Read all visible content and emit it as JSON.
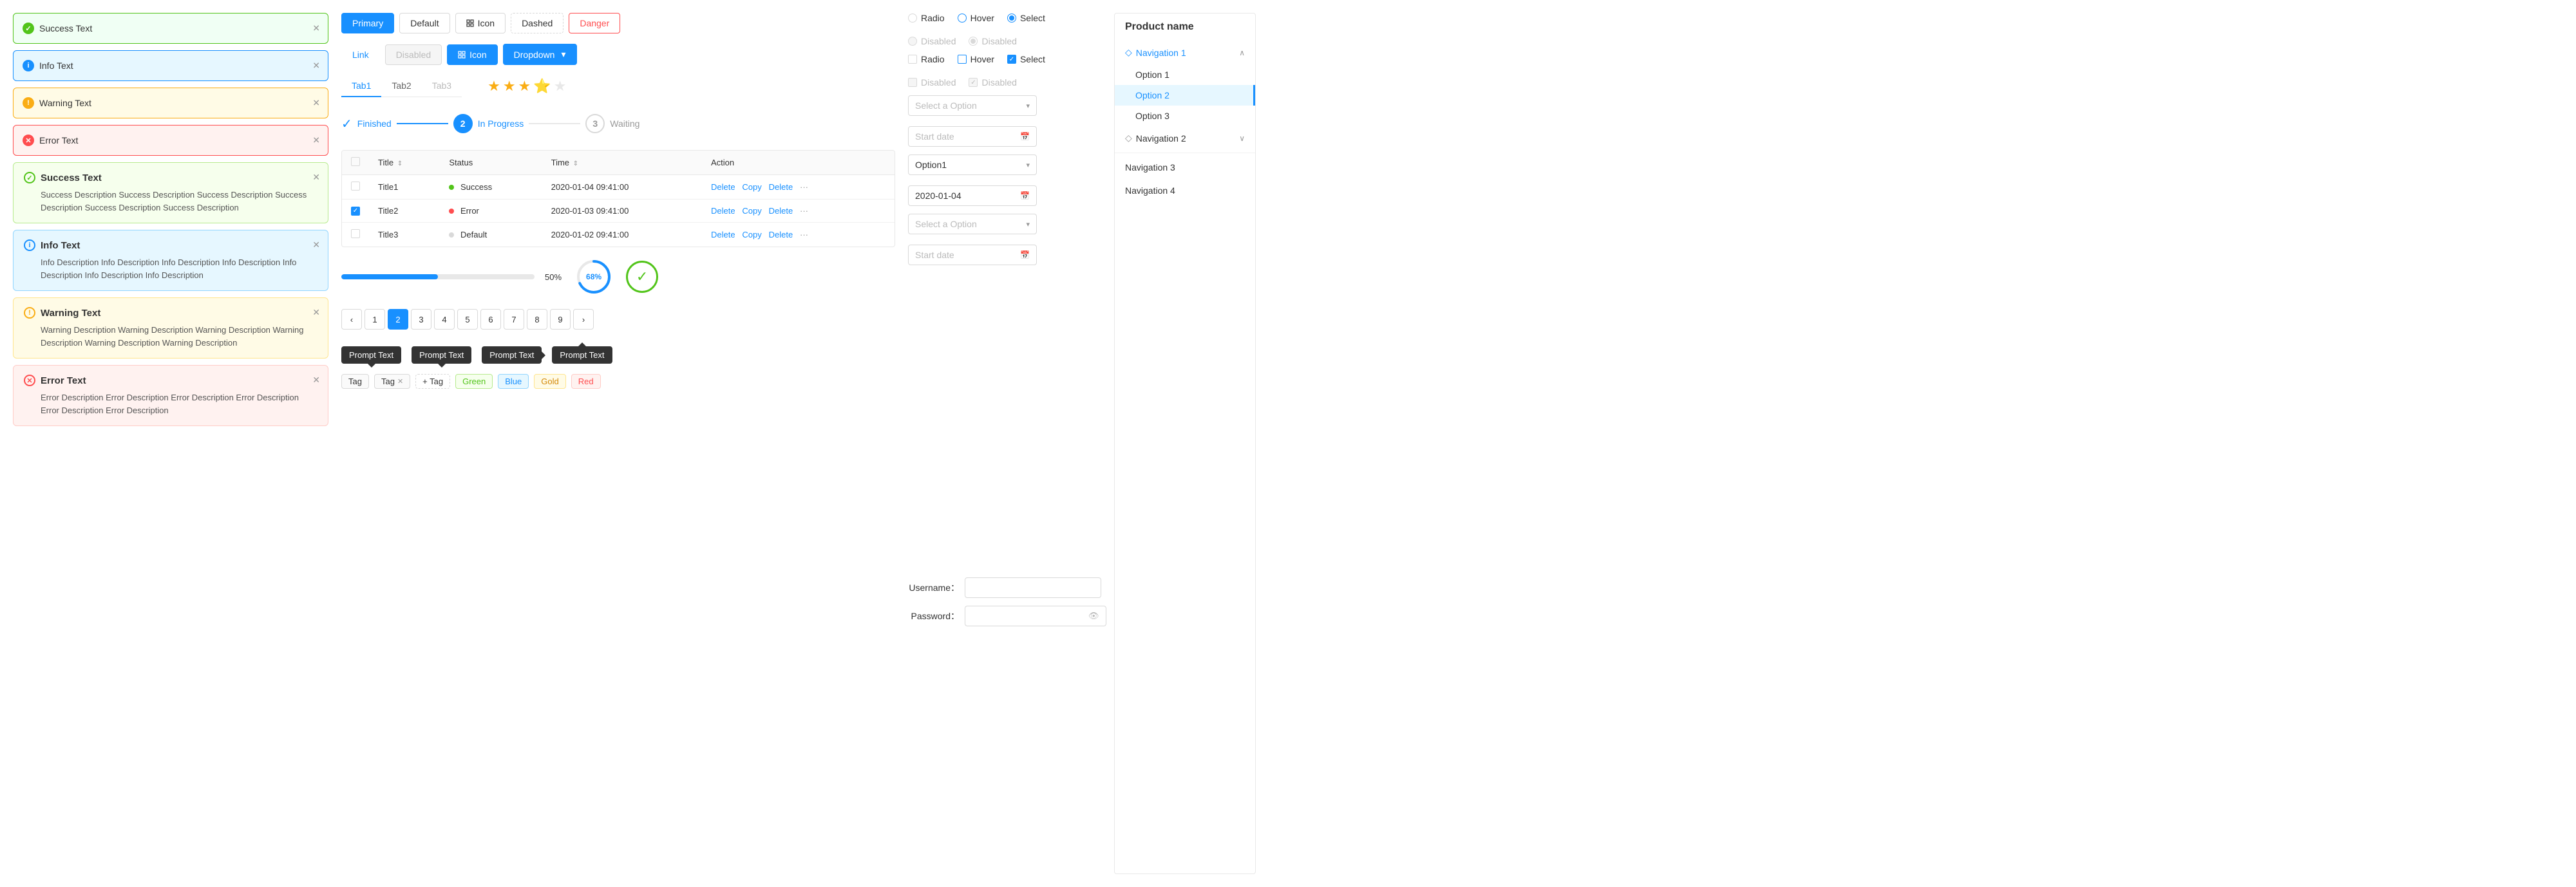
{
  "alerts": {
    "simple": [
      {
        "type": "success",
        "text": "Success Text",
        "icon": "✓"
      },
      {
        "type": "info",
        "text": "Info Text",
        "icon": "i"
      },
      {
        "type": "warning",
        "text": "Warning Text",
        "icon": "!"
      },
      {
        "type": "error",
        "text": "Error Text",
        "icon": "✕"
      }
    ],
    "complex": [
      {
        "type": "success",
        "title": "Success Text",
        "desc": "Success Description Success Description Success Description Success Description Success Description Success Description",
        "icon": "✓"
      },
      {
        "type": "info",
        "title": "Info Text",
        "desc": "Info Description Info Description Info Description Info Description Info Description Info Description Info Description",
        "icon": "i"
      },
      {
        "type": "warning",
        "title": "Warning Text",
        "desc": "Warning Description Warning Description Warning Description Warning Description Warning Description Warning Description",
        "icon": "!"
      },
      {
        "type": "error",
        "title": "Error Text",
        "desc": "Error Description Error Description Error Description Error Description Error Description Error Description",
        "icon": "✕"
      }
    ]
  },
  "buttons": {
    "row1": [
      {
        "label": "Primary",
        "type": "primary"
      },
      {
        "label": "Default",
        "type": "default"
      },
      {
        "label": "Icon",
        "type": "icon"
      },
      {
        "label": "Dashed",
        "type": "dashed"
      },
      {
        "label": "Danger",
        "type": "danger"
      }
    ],
    "row2": [
      {
        "label": "Link",
        "type": "link"
      },
      {
        "label": "Disabled",
        "type": "disabled"
      },
      {
        "label": "Icon",
        "type": "icon-blue"
      },
      {
        "label": "Dropdown",
        "type": "dropdown"
      }
    ]
  },
  "tabs": {
    "items": [
      {
        "label": "Tab1",
        "active": true,
        "disabled": false
      },
      {
        "label": "Tab2",
        "active": false,
        "disabled": false
      },
      {
        "label": "Tab3",
        "active": false,
        "disabled": true
      }
    ]
  },
  "stars": {
    "filled": 3,
    "half": 1,
    "empty": 1
  },
  "selects": {
    "placeholder1": "Select a Option",
    "option1": "Option1",
    "placeholder2": "Select a Option",
    "date1": "2020-01-04",
    "datePlaceholder1": "Start date",
    "datePlaceholder2": "Start date"
  },
  "steps": [
    {
      "label": "Finished",
      "status": "finished",
      "num": ""
    },
    {
      "label": "In Progress",
      "status": "in-progress",
      "num": "2"
    },
    {
      "label": "Waiting",
      "status": "waiting",
      "num": "3"
    }
  ],
  "table": {
    "columns": [
      "",
      "Title",
      "Status",
      "Time",
      "Action"
    ],
    "rows": [
      {
        "checked": false,
        "title": "Title1",
        "status": "Success",
        "statusType": "success",
        "time": "2020-01-04  09:41:00"
      },
      {
        "checked": true,
        "title": "Title2",
        "status": "Error",
        "statusType": "error",
        "time": "2020-01-03  09:41:00"
      },
      {
        "checked": false,
        "title": "Title3",
        "status": "Default",
        "statusType": "default",
        "time": "2020-01-02  09:41:00"
      }
    ],
    "actions": [
      "Delete",
      "Copy",
      "Delete"
    ]
  },
  "pagination": {
    "pages": [
      1,
      2,
      3,
      4,
      5,
      6,
      7,
      8,
      9
    ],
    "active": 2
  },
  "progress": {
    "bar_percent": 50,
    "bar_label": "50%",
    "circle_percent": 68,
    "circle_label": "68%"
  },
  "tooltips": [
    {
      "label": "Prompt Text",
      "position": "top"
    },
    {
      "label": "Prompt Text",
      "position": "top"
    },
    {
      "label": "Prompt Text",
      "position": "right"
    },
    {
      "label": "Prompt Text",
      "position": "bottom"
    }
  ],
  "tags": [
    {
      "label": "Tag",
      "type": "default",
      "closable": false
    },
    {
      "label": "Tag",
      "type": "default",
      "closable": true
    },
    {
      "label": "+ Tag",
      "type": "add",
      "closable": false
    },
    {
      "label": "Green",
      "type": "green",
      "closable": false
    },
    {
      "label": "Blue",
      "type": "blue",
      "closable": false
    },
    {
      "label": "Gold",
      "type": "gold",
      "closable": false
    },
    {
      "label": "Red",
      "type": "red",
      "closable": false
    }
  ],
  "rightControls": {
    "row1": {
      "radios": [
        {
          "label": "Radio",
          "state": "unchecked"
        },
        {
          "label": "Hover",
          "state": "hover"
        },
        {
          "label": "Select",
          "state": "checked"
        },
        {
          "label": "Disabled",
          "state": "disabled"
        },
        {
          "label": "Disabled",
          "state": "disabled-checked"
        }
      ]
    },
    "row2": {
      "checkboxes": [
        {
          "label": "Radio",
          "state": "unchecked"
        },
        {
          "label": "Hover",
          "state": "hover"
        },
        {
          "label": "Select",
          "state": "checked"
        },
        {
          "label": "Disabled",
          "state": "disabled"
        },
        {
          "label": "Disabled",
          "state": "disabled-checked"
        }
      ]
    }
  },
  "navigation": {
    "title": "Product name",
    "items": [
      {
        "label": "Navigation 1",
        "expanded": true,
        "icon": "diamond",
        "children": [
          {
            "label": "Option 1",
            "active": false
          },
          {
            "label": "Option 2",
            "active": true
          },
          {
            "label": "Option 3",
            "active": false
          }
        ]
      },
      {
        "label": "Navigation 2",
        "expanded": false,
        "icon": "diamond",
        "children": []
      },
      {
        "label": "Navigation 3",
        "expanded": false,
        "icon": "",
        "children": []
      },
      {
        "label": "Navigation 4",
        "expanded": false,
        "icon": "",
        "children": []
      }
    ]
  },
  "loginForm": {
    "usernameLabel": "Username：",
    "passwordLabel": "Password：",
    "usernamePlaceholder": "",
    "passwordPlaceholder": ""
  }
}
